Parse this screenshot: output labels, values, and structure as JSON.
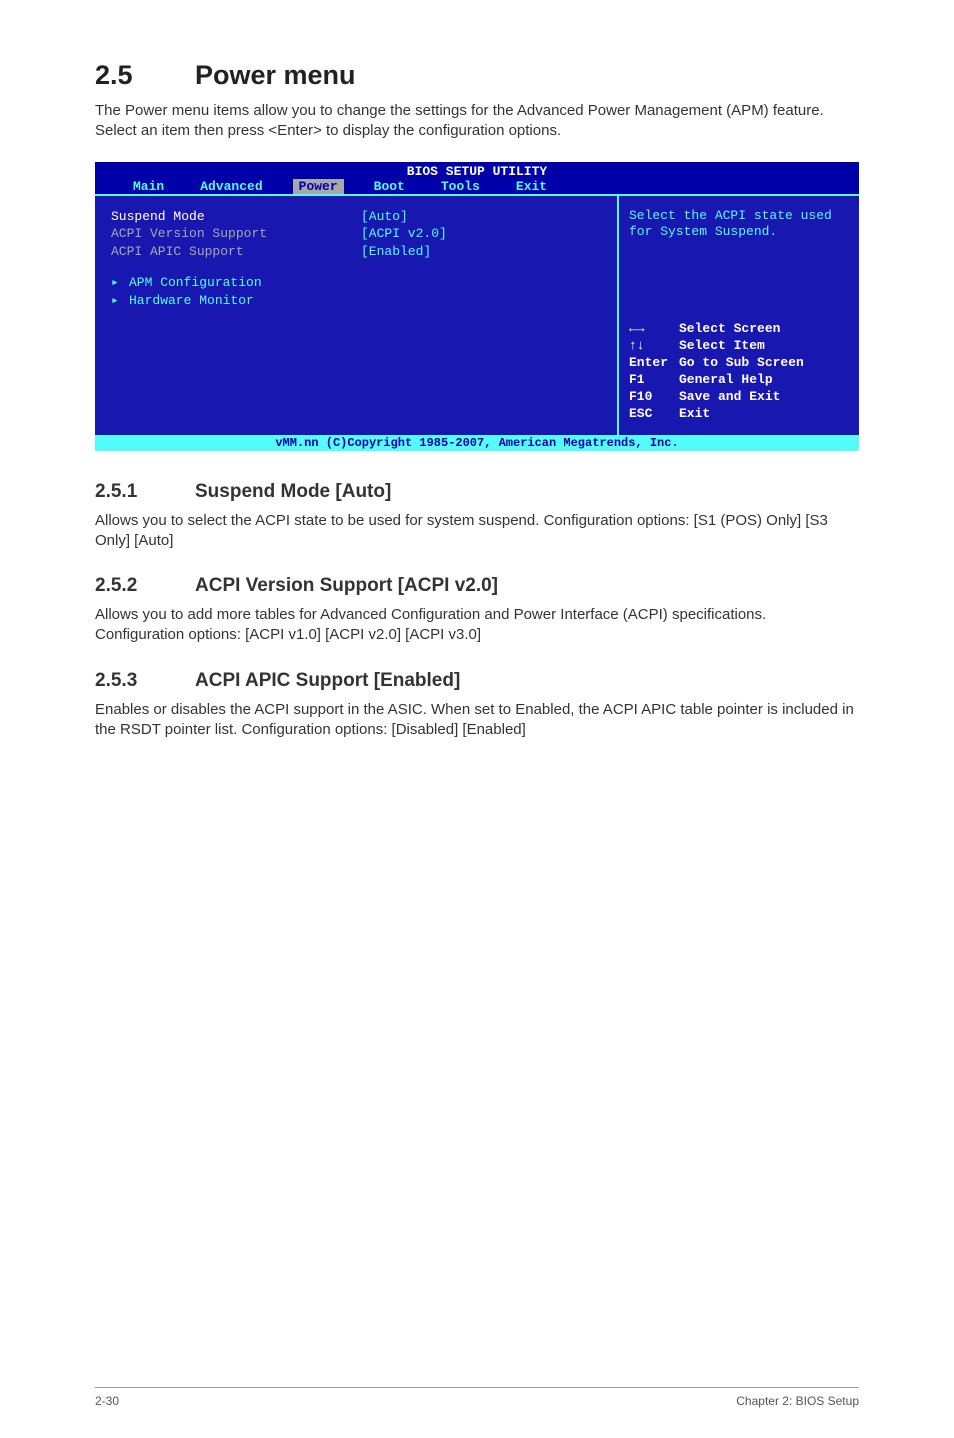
{
  "section": {
    "number": "2.5",
    "title": "Power menu",
    "intro": "The Power menu items allow you to change the settings for the Advanced Power Management (APM) feature. Select an item then press <Enter> to display the configuration options."
  },
  "bios": {
    "header": "BIOS SETUP UTILITY",
    "tabs": [
      "Main",
      "Advanced",
      "Power",
      "Boot",
      "Tools",
      "Exit"
    ],
    "active_tab_index": 2,
    "rows": [
      {
        "label": "Suspend Mode",
        "value": "[Auto]",
        "highlight": true
      },
      {
        "label": "ACPI Version Support",
        "value": "[ACPI v2.0]",
        "highlight": false
      },
      {
        "label": "ACPI APIC Support",
        "value": "[Enabled]",
        "highlight": false
      }
    ],
    "submenus": [
      "APM Configuration",
      "Hardware Monitor"
    ],
    "help_text": "Select the ACPI state used for System Suspend.",
    "keys": [
      {
        "k": "←→",
        "d": "Select Screen"
      },
      {
        "k": "↑↓",
        "d": "Select Item"
      },
      {
        "k": "Enter",
        "d": "Go to Sub Screen"
      },
      {
        "k": "F1",
        "d": "General Help"
      },
      {
        "k": "F10",
        "d": "Save and Exit"
      },
      {
        "k": "ESC",
        "d": "Exit"
      }
    ],
    "footer": "vMM.nn (C)Copyright 1985-2007, American Megatrends, Inc."
  },
  "subsections": [
    {
      "number": "2.5.1",
      "title": "Suspend Mode [Auto]",
      "body": "Allows you to select the ACPI state to be used for system suspend. Configuration options: [S1 (POS) Only] [S3 Only] [Auto]"
    },
    {
      "number": "2.5.2",
      "title": "ACPI Version Support [ACPI v2.0]",
      "body": "Allows you to add more tables for Advanced Configuration and Power Interface (ACPI) specifications. Configuration options: [ACPI v1.0] [ACPI v2.0] [ACPI v3.0]"
    },
    {
      "number": "2.5.3",
      "title": "ACPI APIC Support [Enabled]",
      "body": "Enables or disables the ACPI support in the ASIC. When set to Enabled, the ACPI APIC table pointer is included in the RSDT pointer list. Configuration options: [Disabled] [Enabled]"
    }
  ],
  "footer": {
    "left": "2-30",
    "right": "Chapter 2: BIOS Setup"
  }
}
